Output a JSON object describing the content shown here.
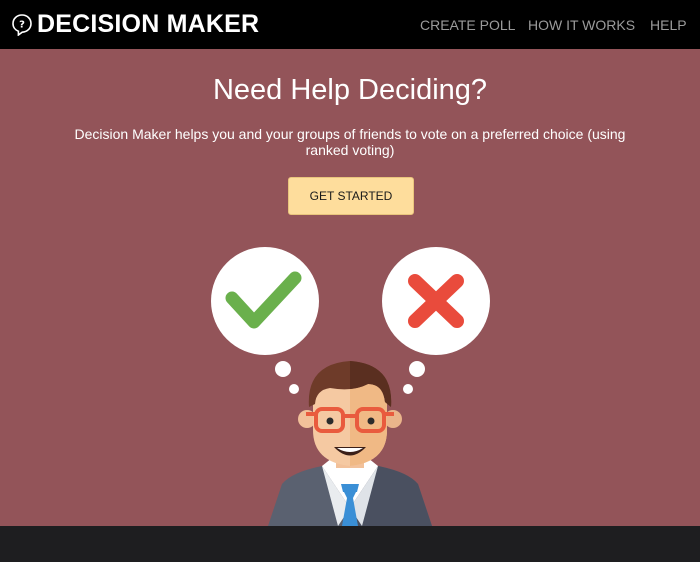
{
  "nav": {
    "brand": "DECISION MAKER",
    "links": [
      "CREATE POLL",
      "HOW IT WORKS",
      "HELP"
    ]
  },
  "hero": {
    "title": "Need Help Deciding?",
    "description": "Decision Maker helps you and your groups of friends to vote on a preferred choice (using ranked voting)",
    "cta_label": "GET STARTED"
  },
  "icons": {
    "brand": "question-bubble-icon",
    "approve": "check-icon",
    "reject": "cross-icon"
  },
  "colors": {
    "background": "#935459",
    "navbar": "#000000",
    "cta": "#fedd9c",
    "check": "#6ab04c",
    "cross": "#e94b3c",
    "footer": "#1e1e20"
  }
}
